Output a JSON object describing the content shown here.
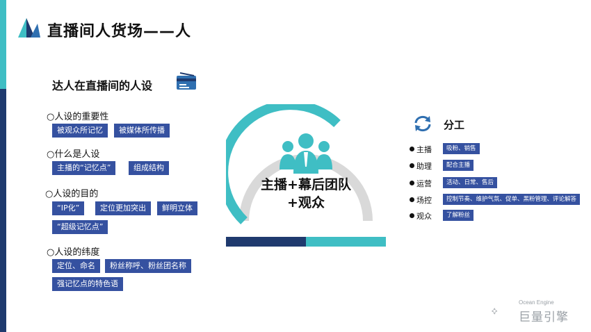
{
  "title": "直播间人货场——人",
  "section_title": "达人在直播间的人设",
  "groups": [
    {
      "heading": "○人设的重要性",
      "tags": [
        "被观众所记忆",
        "被媒体所传播"
      ]
    },
    {
      "heading": "○什么是人设",
      "tags": [
        "主播的“记忆点”",
        "组成结构"
      ]
    },
    {
      "heading": "○人设的目的",
      "tags": [
        "“IP化”",
        "定位更加突出",
        "鲜明立体",
        "“超级记忆点”"
      ]
    },
    {
      "heading": "○人设的纬度",
      "tags": [
        "定位、命名",
        "粉丝称呼、粉丝团名称",
        "强记忆点的特色语"
      ]
    }
  ],
  "center": {
    "line1": "主播+幕后团队",
    "line2": "+观众"
  },
  "division": {
    "title": "分工",
    "roles": [
      {
        "name": "主播",
        "tag": "吸粉、销售"
      },
      {
        "name": "助理",
        "tag": "配合主播"
      },
      {
        "name": "运营",
        "tag": "活动、日常、售后"
      },
      {
        "name": "场控",
        "tag": "控制节奏、维护气氛、促单、黑粉管理、评论解答"
      },
      {
        "name": "观众",
        "tag": "了解粉丝"
      }
    ]
  },
  "brand": {
    "sub": "Ocean Engine",
    "name": "巨量引擎"
  },
  "colors": {
    "navy": "#1f3a6e",
    "tag_blue": "#3551a0",
    "teal": "#3fbec4",
    "grey": "#d9d9d9"
  },
  "icons": [
    "logo-icon",
    "card-icon",
    "team-icon",
    "refresh-icon",
    "brand-icon"
  ]
}
